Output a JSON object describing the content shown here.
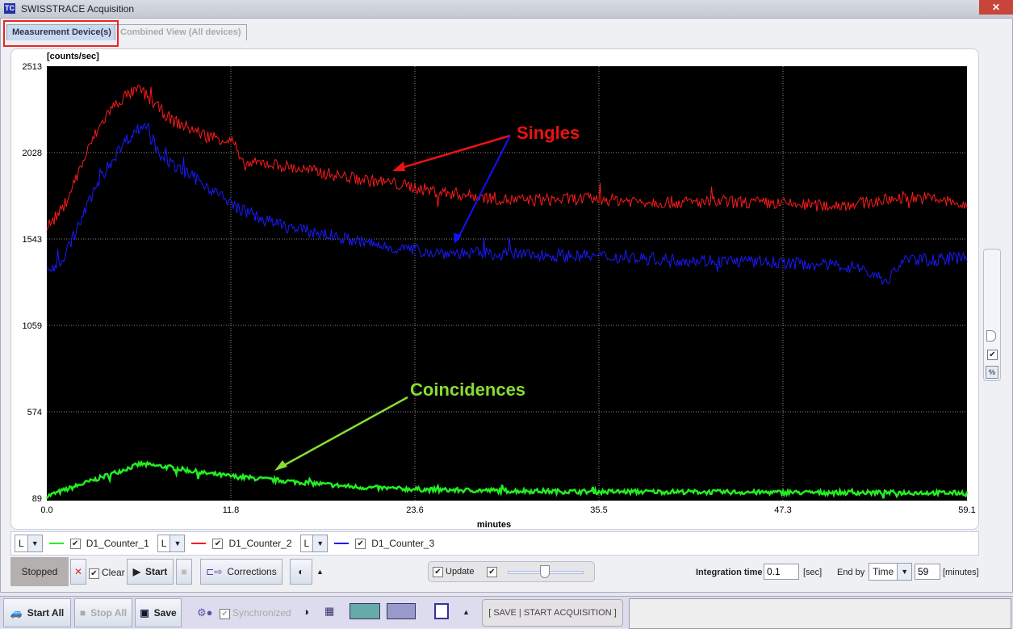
{
  "window": {
    "title": "SWISSTRACE Acquisition"
  },
  "tabs": [
    {
      "label": "Measurement Device(s)",
      "active": true
    },
    {
      "label": "Combined View (All devices)",
      "active": false
    }
  ],
  "chart_data": {
    "type": "line",
    "ylabel": "[counts/sec]",
    "xlabel": "minutes",
    "xlim": [
      0,
      59.1
    ],
    "ylim": [
      89,
      2513
    ],
    "xticks": [
      "0.0",
      "11.8",
      "23.6",
      "35.5",
      "47.3",
      "59.1"
    ],
    "yticks": [
      "89",
      "574",
      "1059",
      "1543",
      "2028",
      "2513"
    ],
    "grid": true,
    "background": "#000000",
    "series": [
      {
        "name": "D1_Counter_1",
        "color": "#22ee22",
        "x": [
          0,
          2,
          4,
          6,
          8,
          10,
          12,
          14,
          16,
          20,
          25,
          30,
          35,
          40,
          45,
          50,
          55,
          59.1
        ],
        "y": [
          100,
          160,
          220,
          280,
          260,
          230,
          210,
          195,
          180,
          150,
          135,
          130,
          125,
          125,
          122,
          120,
          120,
          118
        ]
      },
      {
        "name": "D1_Counter_2",
        "color": "#ff1a1a",
        "x": [
          0,
          1,
          2,
          3,
          4,
          5,
          6,
          7,
          8,
          10,
          12,
          12.5,
          14,
          16,
          18,
          20,
          22,
          25,
          28,
          30,
          35,
          40,
          45,
          50,
          53,
          55,
          57,
          59.1
        ],
        "y": [
          1600,
          1700,
          1900,
          2100,
          2250,
          2330,
          2370,
          2280,
          2200,
          2120,
          2080,
          1950,
          1960,
          1930,
          1900,
          1870,
          1850,
          1800,
          1770,
          1750,
          1760,
          1740,
          1740,
          1720,
          1740,
          1770,
          1760,
          1720
        ]
      },
      {
        "name": "D1_Counter_3",
        "color": "#1a1aff",
        "x": [
          0,
          1,
          2,
          3,
          4,
          5,
          6,
          6.5,
          7,
          8,
          10,
          12,
          14,
          16,
          18,
          20,
          22,
          25,
          30,
          35,
          40,
          45,
          48,
          50,
          52,
          54,
          55,
          57,
          59.1
        ],
        "y": [
          1350,
          1420,
          1600,
          1800,
          1950,
          2080,
          2160,
          2170,
          2050,
          1950,
          1850,
          1720,
          1640,
          1590,
          1560,
          1520,
          1490,
          1460,
          1450,
          1440,
          1420,
          1410,
          1400,
          1390,
          1380,
          1300,
          1420,
          1420,
          1430
        ]
      }
    ],
    "annotations": [
      {
        "text": "Singles",
        "color": "#ee1111"
      },
      {
        "text": "Coincidences",
        "color": "#88dd33"
      }
    ]
  },
  "legend": [
    {
      "axis": "L",
      "label": "D1_Counter_1",
      "checked": true
    },
    {
      "axis": "L",
      "label": "D1_Counter_2",
      "checked": true
    },
    {
      "axis": "L",
      "label": "D1_Counter_3",
      "checked": true
    }
  ],
  "controls": {
    "status": "Stopped",
    "clear": "Clear",
    "start": "Start",
    "corrections": "Corrections",
    "update": "Update",
    "integration_label": "Integration time",
    "integration_value": "0.1",
    "integration_unit": "[sec]",
    "endby_label": "End by",
    "endby_value": "Time",
    "end_value": "59",
    "end_unit": "[minutes]",
    "percent": "%"
  },
  "bottom": {
    "start_all": "Start All",
    "stop_all": "Stop All",
    "save": "Save",
    "synchronized": "Synchronized",
    "save_start": "[ SAVE | START ACQUISITION ]"
  }
}
